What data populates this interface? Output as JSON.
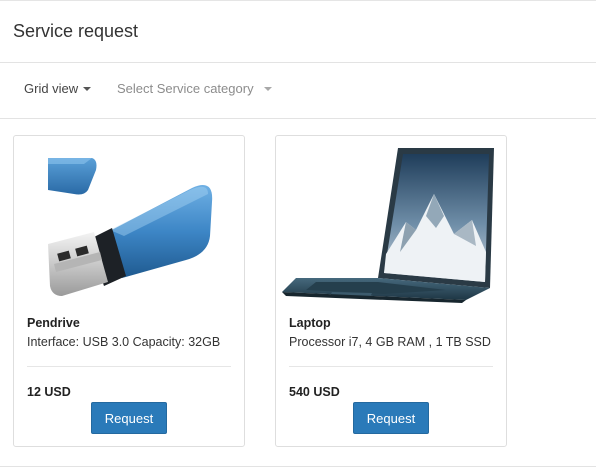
{
  "page": {
    "title": "Service request"
  },
  "toolbar": {
    "view_label": "Grid view",
    "category_placeholder": "Select Service category"
  },
  "items": [
    {
      "title": "Pendrive",
      "description": "Interface: USB 3.0 Capacity: 32GB",
      "price": "12 USD",
      "button_label": "Request",
      "image_icon": "usb-pendrive-image"
    },
    {
      "title": "Laptop",
      "description": "Processor i7, 4 GB RAM , 1 TB SSD",
      "price": "540 USD",
      "button_label": "Request",
      "image_icon": "laptop-image"
    }
  ],
  "colors": {
    "primary_button": "#2a7ab9",
    "pendrive_body": "#3d86c6",
    "laptop_body": "#2d4f62"
  }
}
